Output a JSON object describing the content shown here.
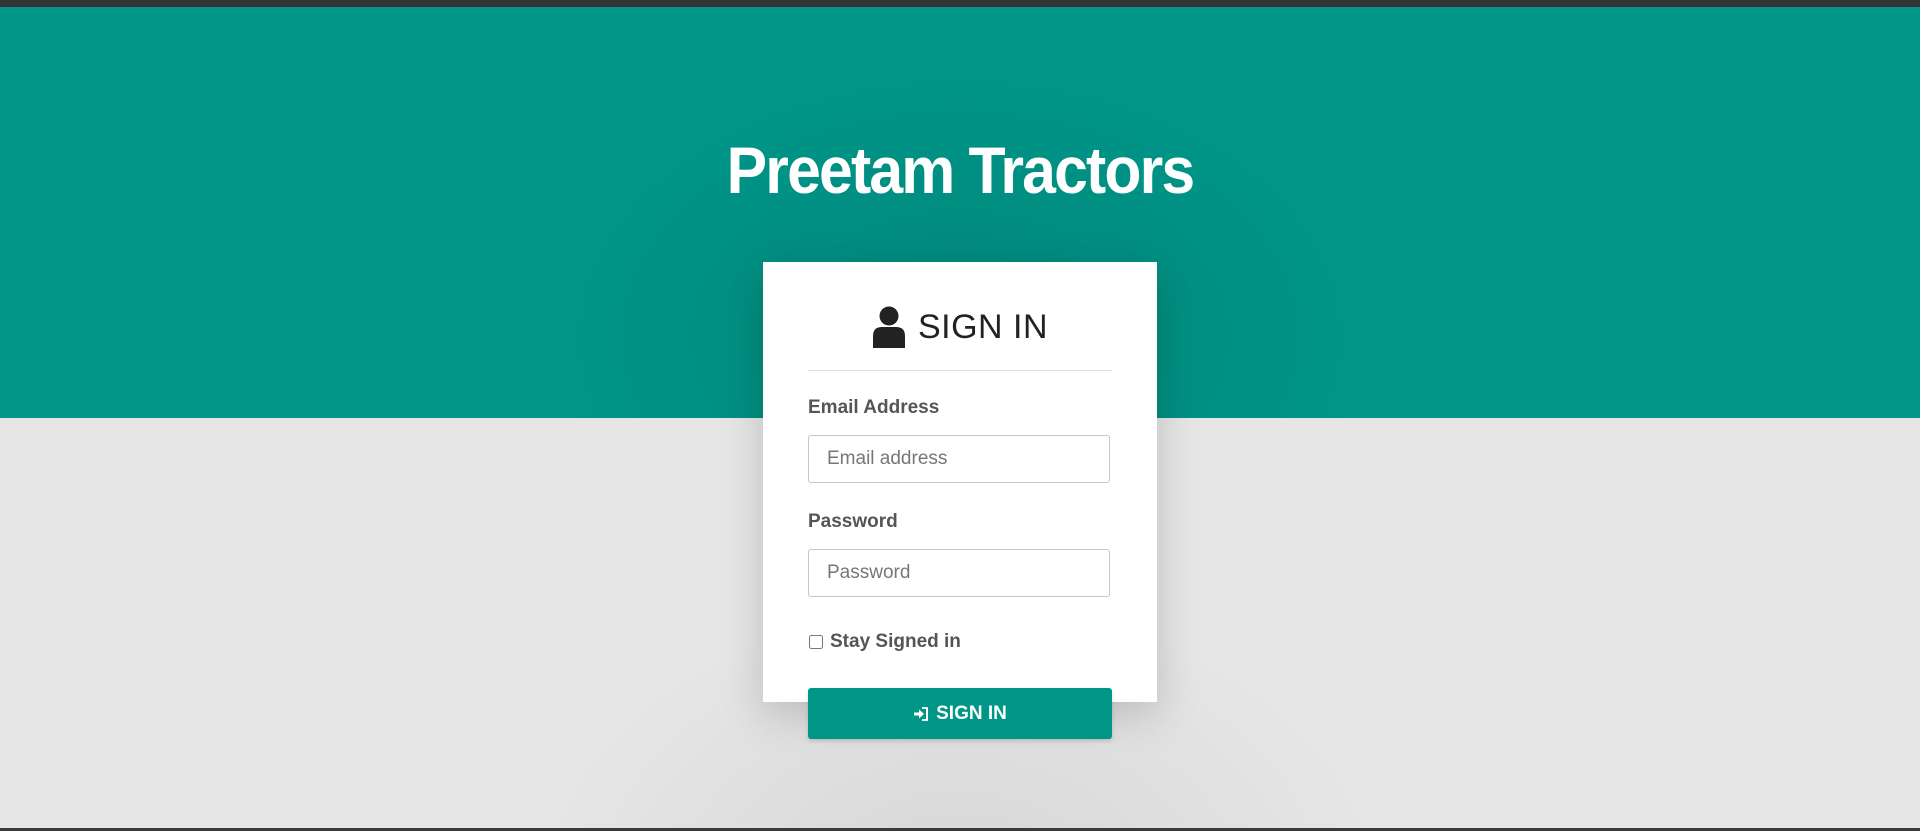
{
  "brand": {
    "title": "Preetam Tractors"
  },
  "login_card": {
    "heading": "SIGN IN",
    "heading_icon": "user-icon",
    "email": {
      "label": "Email Address",
      "placeholder": "Email address",
      "value": ""
    },
    "password": {
      "label": "Password",
      "placeholder": "Password",
      "value": ""
    },
    "remember": {
      "label": "Stay Signed in",
      "checked": false
    },
    "submit": {
      "label": "SIGN IN",
      "icon": "sign-in-icon"
    }
  },
  "colors": {
    "accent": "#009688",
    "page_background": "#e6e6e6",
    "top_strip": "#333333",
    "card_background": "#ffffff",
    "heading_text": "#222222",
    "label_text": "#555555"
  }
}
